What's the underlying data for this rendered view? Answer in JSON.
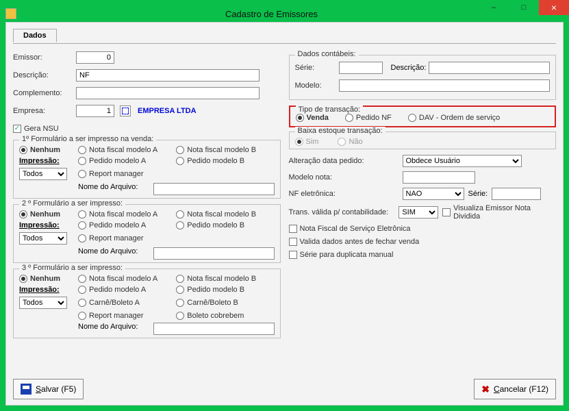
{
  "window": {
    "title": "Cadastro de Emissores",
    "min": "–",
    "max": "□",
    "close": "×"
  },
  "tab": {
    "dados": "Dados"
  },
  "left": {
    "emissor_lbl": "Emissor:",
    "emissor_val": "0",
    "desc_lbl": "Descrição:",
    "desc_val": "NF",
    "comp_lbl": "Complemento:",
    "comp_val": "",
    "emp_lbl": "Empresa:",
    "emp_val": "1",
    "emp_name": "EMPRESA LTDA",
    "gera_nsu": "Gera NSU",
    "fs1": {
      "legend": "1º Formulário a ser impresso na venda:",
      "nenhum": "Nenhum",
      "nfa": "Nota fiscal modelo A",
      "nfb": "Nota fiscal modelo B",
      "impress": "Impressão:",
      "pa": "Pedido modelo A",
      "pb": "Pedido modelo B",
      "todos": "Todos",
      "rm": "Report manager",
      "arquivo": "Nome do Arquivo:"
    },
    "fs2": {
      "legend": "2 º Formulário a ser impresso:",
      "nenhum": "Nenhum",
      "nfa": "Nota fiscal modelo A",
      "nfb": "Nota fiscal modelo B",
      "impress": "Impressão:",
      "pa": "Pedido modelo A",
      "pb": "Pedido modelo B",
      "todos": "Todos",
      "rm": "Report manager",
      "arquivo": "Nome do Arquivo:"
    },
    "fs3": {
      "legend": "3 º Formulário a ser impresso:",
      "nenhum": "Nenhum",
      "nfa": "Nota fiscal modelo A",
      "nfb": "Nota fiscal modelo B",
      "impress": "Impressão:",
      "pa": "Pedido modelo A",
      "pb": "Pedido modelo B",
      "todos": "Todos",
      "ca": "Carnê/Boleto A",
      "cb": "Carnê/Boleto B",
      "rm": "Report manager",
      "bc": "Boleto cobrebem",
      "arquivo": "Nome do Arquivo:"
    }
  },
  "right": {
    "contab": {
      "legend": "Dados contábeis:",
      "serie": "Série:",
      "desc": "Descrição:",
      "modelo": "Modelo:"
    },
    "tipo": {
      "legend": "Tipo de transação:",
      "venda": "Venda",
      "pnf": "Pedido NF",
      "dav": "DAV - Ordem de serviço"
    },
    "baixa": {
      "legend": "Baixa estoque transação:",
      "sim": "Sim",
      "nao": "Não"
    },
    "alt_data": "Alteração data pedido:",
    "alt_val": "Obdece Usuário",
    "modelo_nota": "Modelo nota:",
    "nfe": "NF eletrônica:",
    "nfe_val": "NAO",
    "serie2": "Série:",
    "trans": "Trans. válida p/ contabilidade:",
    "trans_val": "SIM",
    "vis": "Visualiza Emissor Nota Dividida",
    "c1": "Nota Fiscal de Serviço Eletrônica",
    "c2": "Valida dados antes de fechar venda",
    "c3": "Série para duplicata manual"
  },
  "buttons": {
    "salvar": "Salvar (F5)",
    "cancelar": "Cancelar (F12)",
    "s_u": "S",
    "c_u": "C"
  }
}
